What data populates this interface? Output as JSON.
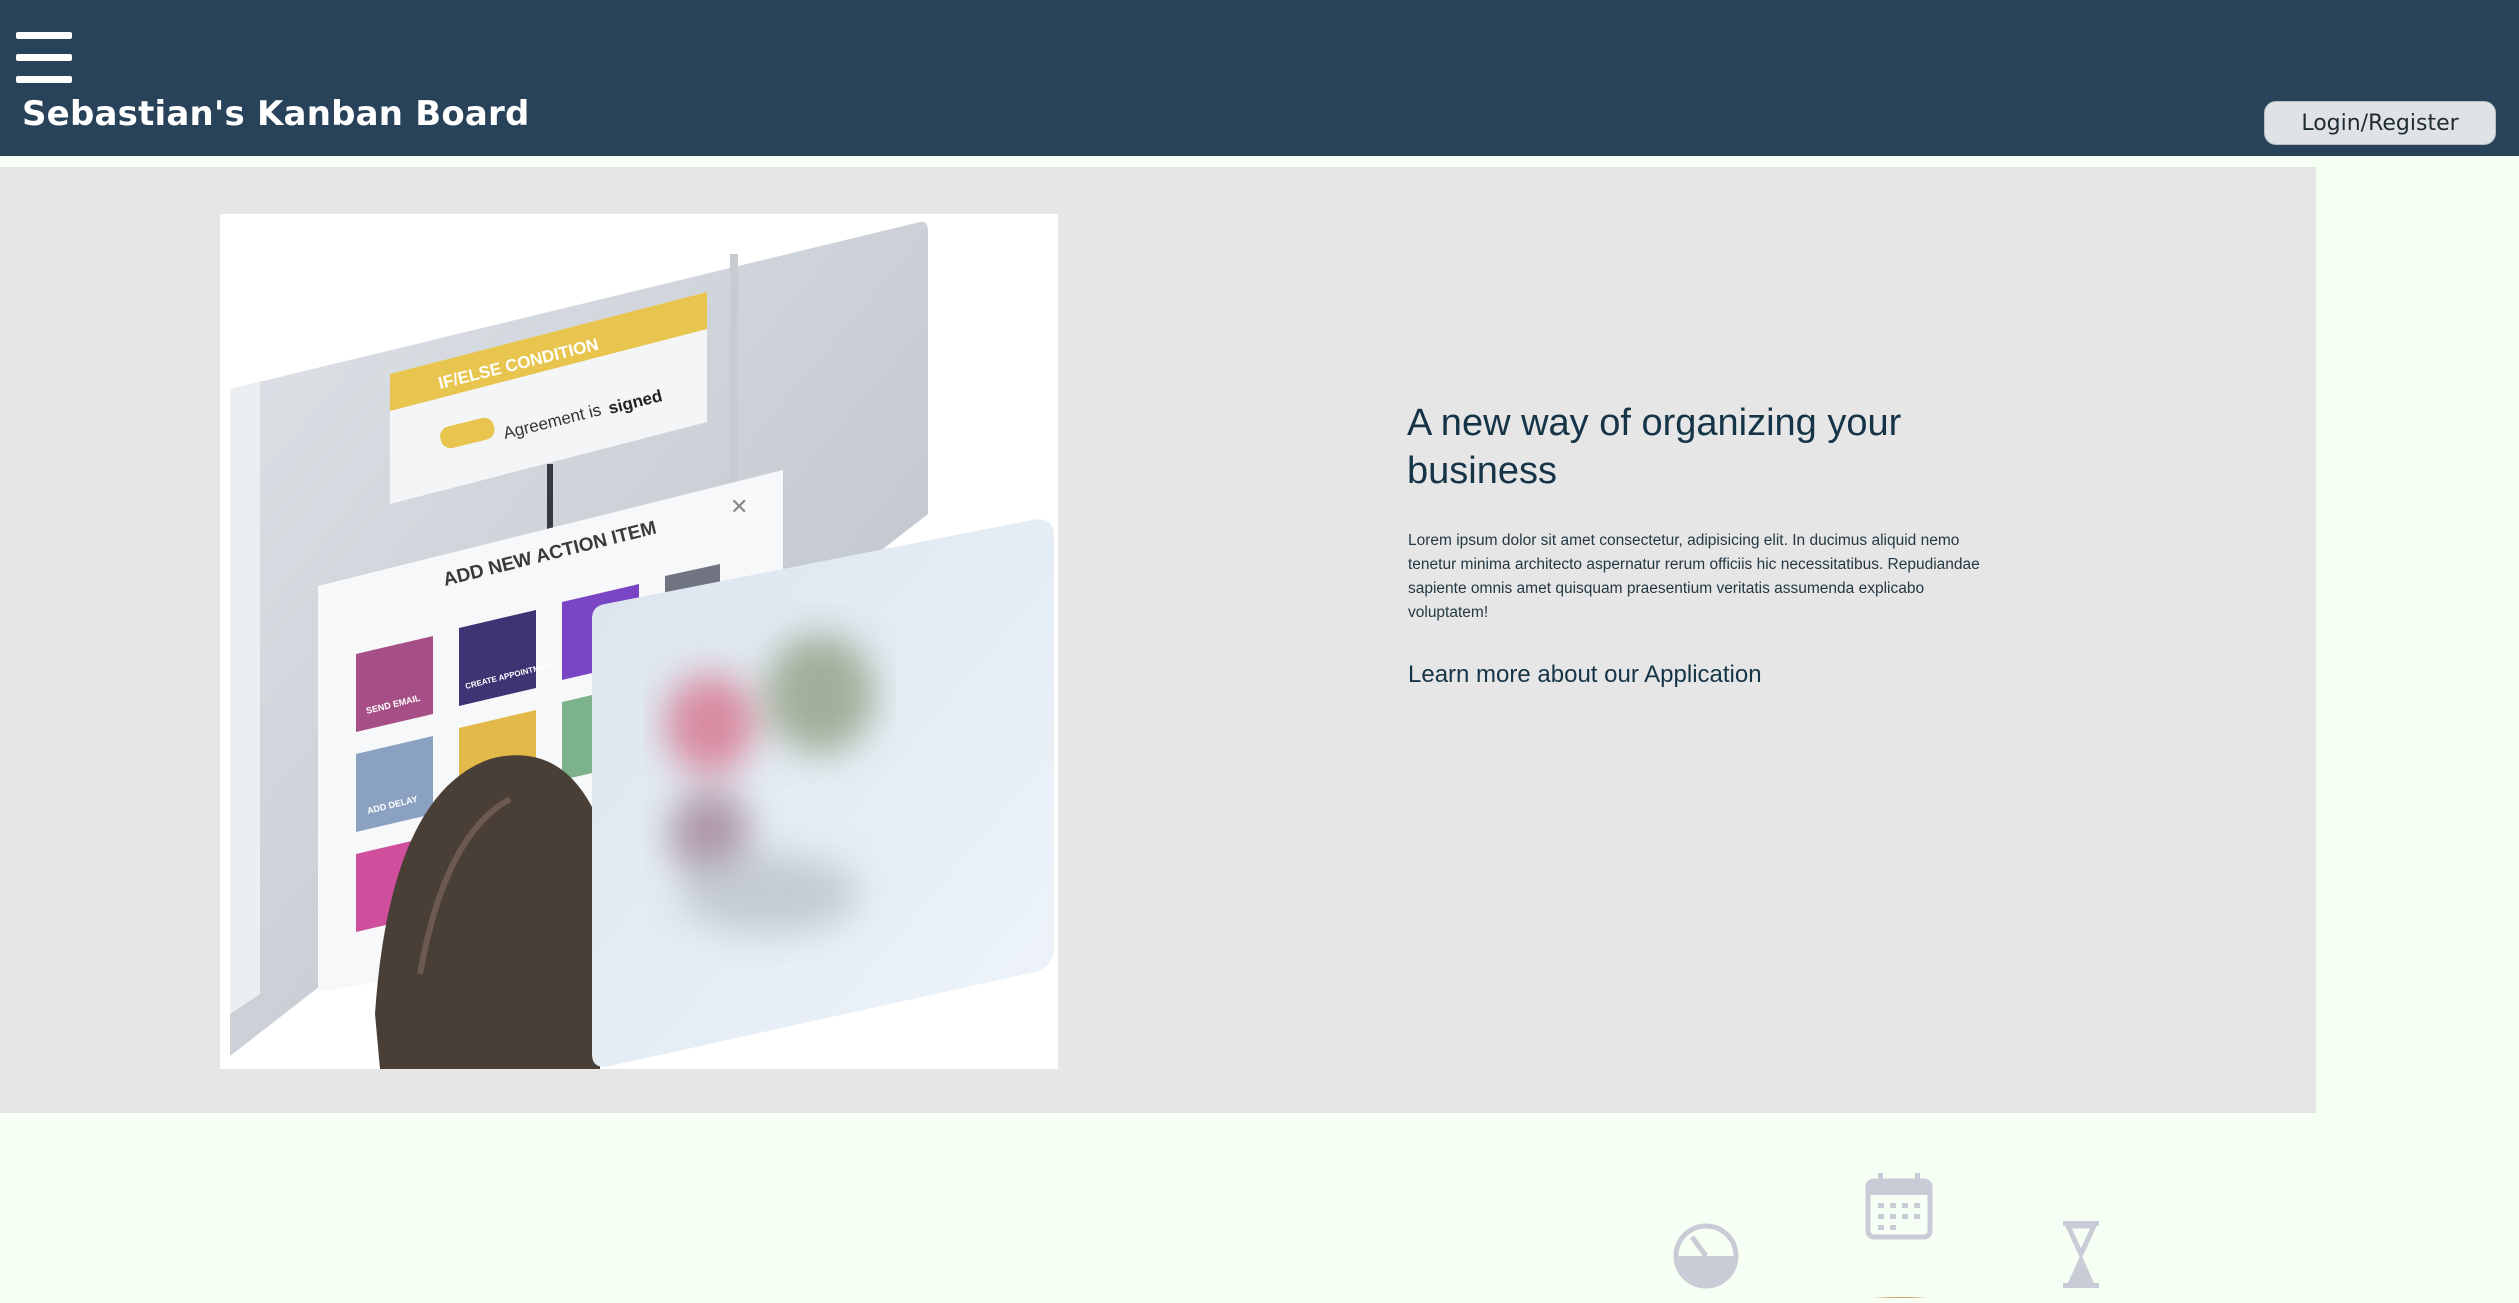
{
  "header": {
    "brand": "Sebastian's Kanban Board",
    "login_label": "Login/Register",
    "menu_icon": "hamburger-menu-icon"
  },
  "hero": {
    "headline": "A new way of organizing your business",
    "body": "Lorem ipsum dolor sit amet consectetur, adipisicing elit. In ducimus aliquid nemo tenetur minima architecto aspernatur rerum officiis hic necessitatibus. Repudiandae sapiente omnis amet quisquam praesentium veritatis assumenda explicabo voluptatem!",
    "link_label": "Learn more about our Application",
    "illustration": {
      "condition_title": "IF/ELSE CONDITION",
      "condition_text": "Agreement is",
      "condition_value": "signed",
      "action_title": "ADD NEW ACTION ITEM",
      "tiles": [
        "SEND EMAIL",
        "CREATE APPOINTMENT",
        "ADD DELAY"
      ]
    }
  },
  "bottom": {
    "icons": [
      "gauge-icon",
      "calendar-icon",
      "hourglass-icon"
    ]
  },
  "colors": {
    "navbar": "#284259",
    "hero_bg": "#e6e6e6",
    "page_bg": "#f6fff4",
    "text": "#163447",
    "icon": "#c8ccd6"
  }
}
